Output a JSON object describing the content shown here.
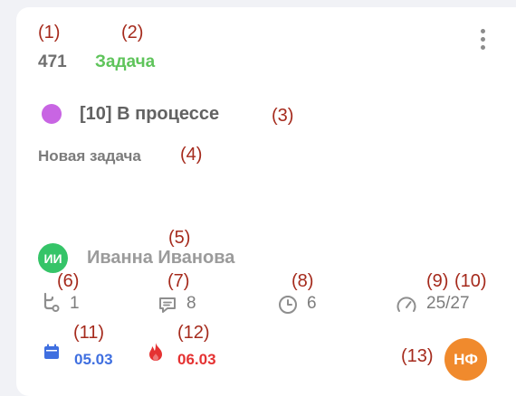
{
  "card": {
    "id": "471",
    "type": "Задача",
    "status": "[10] В процессе",
    "title": "Новая задача",
    "assignee": {
      "initials": "ИИ",
      "name": "Иванна Иванова"
    },
    "metrics": {
      "subtasks": "1",
      "comments": "8",
      "time": "6",
      "progress": "25/27"
    },
    "dates": {
      "start": "05.03",
      "deadline": "06.03"
    },
    "owner_initials": "НФ"
  },
  "annotations": {
    "a1": "(1)",
    "a2": "(2)",
    "a3": "(3)",
    "a4": "(4)",
    "a5": "(5)",
    "a6": "(6)",
    "a7": "(7)",
    "a8": "(8)",
    "a9": "(9)",
    "a10": "(10)",
    "a11": "(11)",
    "a12": "(12)",
    "a13": "(13)"
  },
  "colors": {
    "type": "#5fc45b",
    "status_dot": "#c865e3",
    "assignee_avatar": "#35c468",
    "start_date": "#3f6fe0",
    "deadline": "#e53232",
    "owner_avatar": "#f08a2d",
    "annotation": "#a52a1c"
  },
  "icons": {
    "more": "more-vertical-icon",
    "subtasks": "subtask-tree-icon",
    "comments": "comment-icon",
    "time": "clock-icon",
    "progress": "gauge-icon",
    "start": "calendar-icon",
    "deadline": "fire-icon"
  }
}
